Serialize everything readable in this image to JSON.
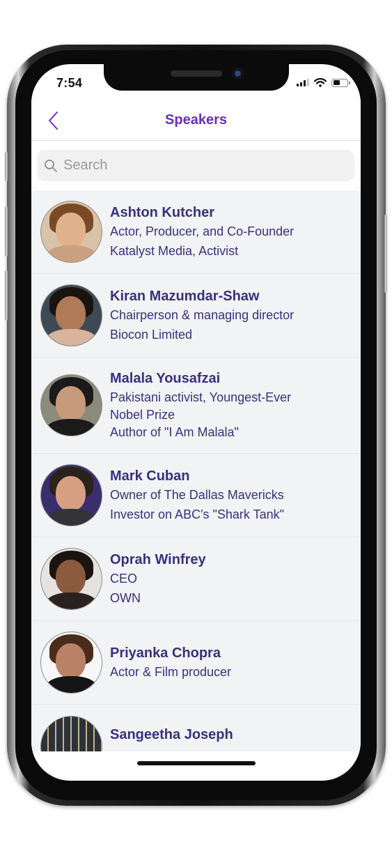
{
  "status_bar": {
    "time": "7:54",
    "icons": [
      "cellular-signal-icon",
      "wifi-icon",
      "battery-icon"
    ],
    "battery_level": 0.55
  },
  "nav": {
    "title": "Speakers",
    "back_icon": "chevron-left-icon"
  },
  "search": {
    "placeholder": "Search",
    "value": "",
    "icon": "search-icon"
  },
  "colors": {
    "accent": "#6a2fb5",
    "text_primary": "#3b2f7a",
    "list_background": "#f1f3f4",
    "search_background": "#f1f1f2",
    "placeholder": "#9a9a9e"
  },
  "speakers": [
    {
      "name": "Ashton Kutcher",
      "lines": [
        "Actor, Producer, and Co-Founder",
        "Katalyst Media, Activist"
      ]
    },
    {
      "name": "Kiran Mazumdar-Shaw",
      "lines": [
        "Chairperson & managing director",
        "Biocon Limited"
      ]
    },
    {
      "name": "Malala Yousafzai",
      "lines": [
        "Pakistani activist, Youngest-Ever",
        "Nobel Prize",
        "Author of \"I Am Malala\""
      ]
    },
    {
      "name": "Mark Cuban",
      "lines": [
        "Owner of The Dallas Mavericks",
        "Investor on ABC's \"Shark Tank\""
      ]
    },
    {
      "name": "Oprah Winfrey",
      "lines": [
        "CEO",
        "OWN"
      ]
    },
    {
      "name": "Priyanka Chopra",
      "lines": [
        "Actor & Film producer"
      ]
    },
    {
      "name": "Sangeetha Joseph",
      "lines": []
    }
  ]
}
